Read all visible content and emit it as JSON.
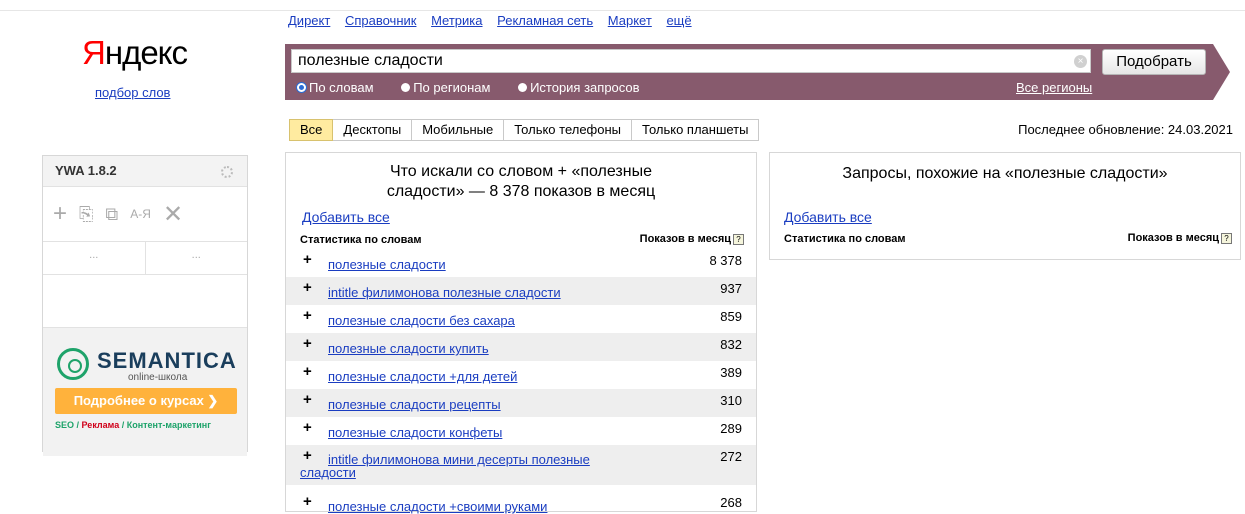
{
  "services": [
    "Директ",
    "Справочник",
    "Метрика",
    "Рекламная сеть",
    "Маркет",
    "ещё"
  ],
  "logo": {
    "first": "Я",
    "rest": "ндекс",
    "sub": "подбор слов"
  },
  "search": {
    "value": "полезные сладости",
    "button": "Подобрать",
    "clear": "×"
  },
  "modes": [
    {
      "label": "По словам",
      "selected": true
    },
    {
      "label": "По регионам",
      "selected": false
    },
    {
      "label": "История запросов",
      "selected": false
    }
  ],
  "regions": "Все регионы",
  "tabs": [
    "Все",
    "Десктопы",
    "Мобильные",
    "Только телефоны",
    "Только планшеты"
  ],
  "updated": "Последнее обновление: 24.03.2021",
  "ywa": {
    "title": "YWA 1.8.2",
    "tools": [
      "+",
      "⎘",
      "⧉",
      "А-Я",
      "✕"
    ],
    "dots": [
      "...",
      "..."
    ],
    "promo": {
      "title": "SEMANTICA",
      "subtitle": "online-школа",
      "button": "Подробнее о курсах ❯",
      "tag1": "SEO",
      "sep1": " / ",
      "tag2": "Реклама",
      "sep2": " / ",
      "tag3": "Контент-маркетинг"
    }
  },
  "left": {
    "title_line1": "Что искали со словом  +  «полезные",
    "title_line2": "сладости» — 8 378 показов в месяц",
    "add_all": "Добавить все",
    "col1": "Статистика по словам",
    "col2": "Показов в месяц",
    "help": "?",
    "rows": [
      {
        "kw": "полезные сладости",
        "num": "8 378"
      },
      {
        "kw": "intitle филимонова полезные сладости",
        "num": "937"
      },
      {
        "kw": "полезные сладости без сахара",
        "num": "859"
      },
      {
        "kw": "полезные сладости купить",
        "num": "832"
      },
      {
        "kw": "полезные сладости +для детей",
        "num": "389"
      },
      {
        "kw": "полезные сладости рецепты",
        "num": "310"
      },
      {
        "kw": "полезные сладости конфеты",
        "num": "289"
      },
      {
        "kw_line1": "intitle филимонова мини десерты полезные",
        "kw_line2": "сладости",
        "num": "272"
      },
      {
        "kw": "полезные сладости +своими руками",
        "num": "268"
      }
    ]
  },
  "right": {
    "title": "Запросы, похожие на «полезные сладости»",
    "add_all": "Добавить все",
    "col1": "Статистика по словам",
    "col2": "Показов в месяц",
    "help": "?"
  },
  "colors": {
    "band": "#875a6d",
    "link": "#1a3dc1",
    "active_tab": "#ffeba0",
    "promo_button": "#ffb23c",
    "promo_green": "#1ea36a"
  }
}
